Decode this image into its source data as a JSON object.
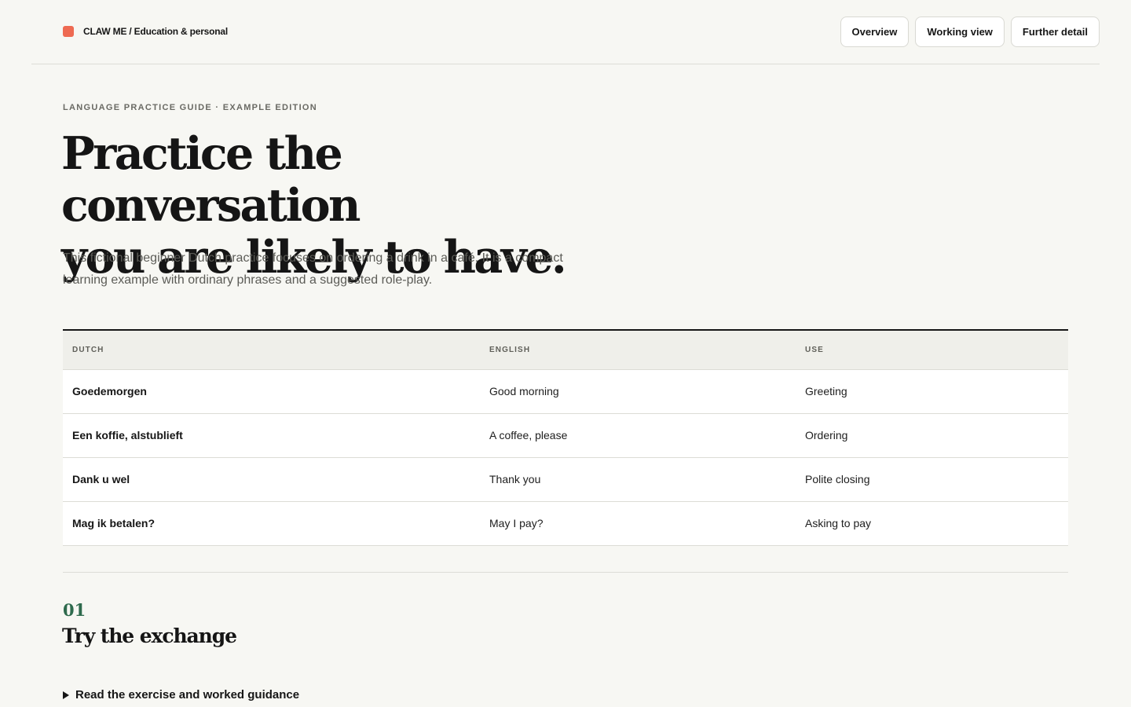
{
  "header": {
    "brand": "CLAW ME / Education & personal",
    "nav": [
      "Overview",
      "Working view",
      "Further detail"
    ]
  },
  "hero": {
    "eyebrow": "LANGUAGE PRACTICE GUIDE · EXAMPLE EDITION",
    "title_line1": "Practice the conversation",
    "title_line2": "you are likely to have.",
    "intro": "This fictional beginner Dutch practice focuses on ordering a drink in a café. It is a compact learning example with ordinary phrases and a suggested role-play."
  },
  "table": {
    "headers": [
      "DUTCH",
      "ENGLISH",
      "USE"
    ],
    "rows": [
      {
        "dutch": "Goedemorgen",
        "english": "Good morning",
        "use": "Greeting"
      },
      {
        "dutch": "Een koffie, alstublieft",
        "english": "A coffee, please",
        "use": "Ordering"
      },
      {
        "dutch": "Dank u wel",
        "english": "Thank you",
        "use": "Polite closing"
      },
      {
        "dutch": "Mag ik betalen?",
        "english": "May I pay?",
        "use": "Asking to pay"
      }
    ]
  },
  "section": {
    "number": "01",
    "title": "Try the exchange",
    "disclosure": "Read the exercise and worked guidance"
  },
  "colors": {
    "brand_mark": "#ee6a52",
    "section_number": "#2e6a4d",
    "background": "#f7f7f3"
  }
}
